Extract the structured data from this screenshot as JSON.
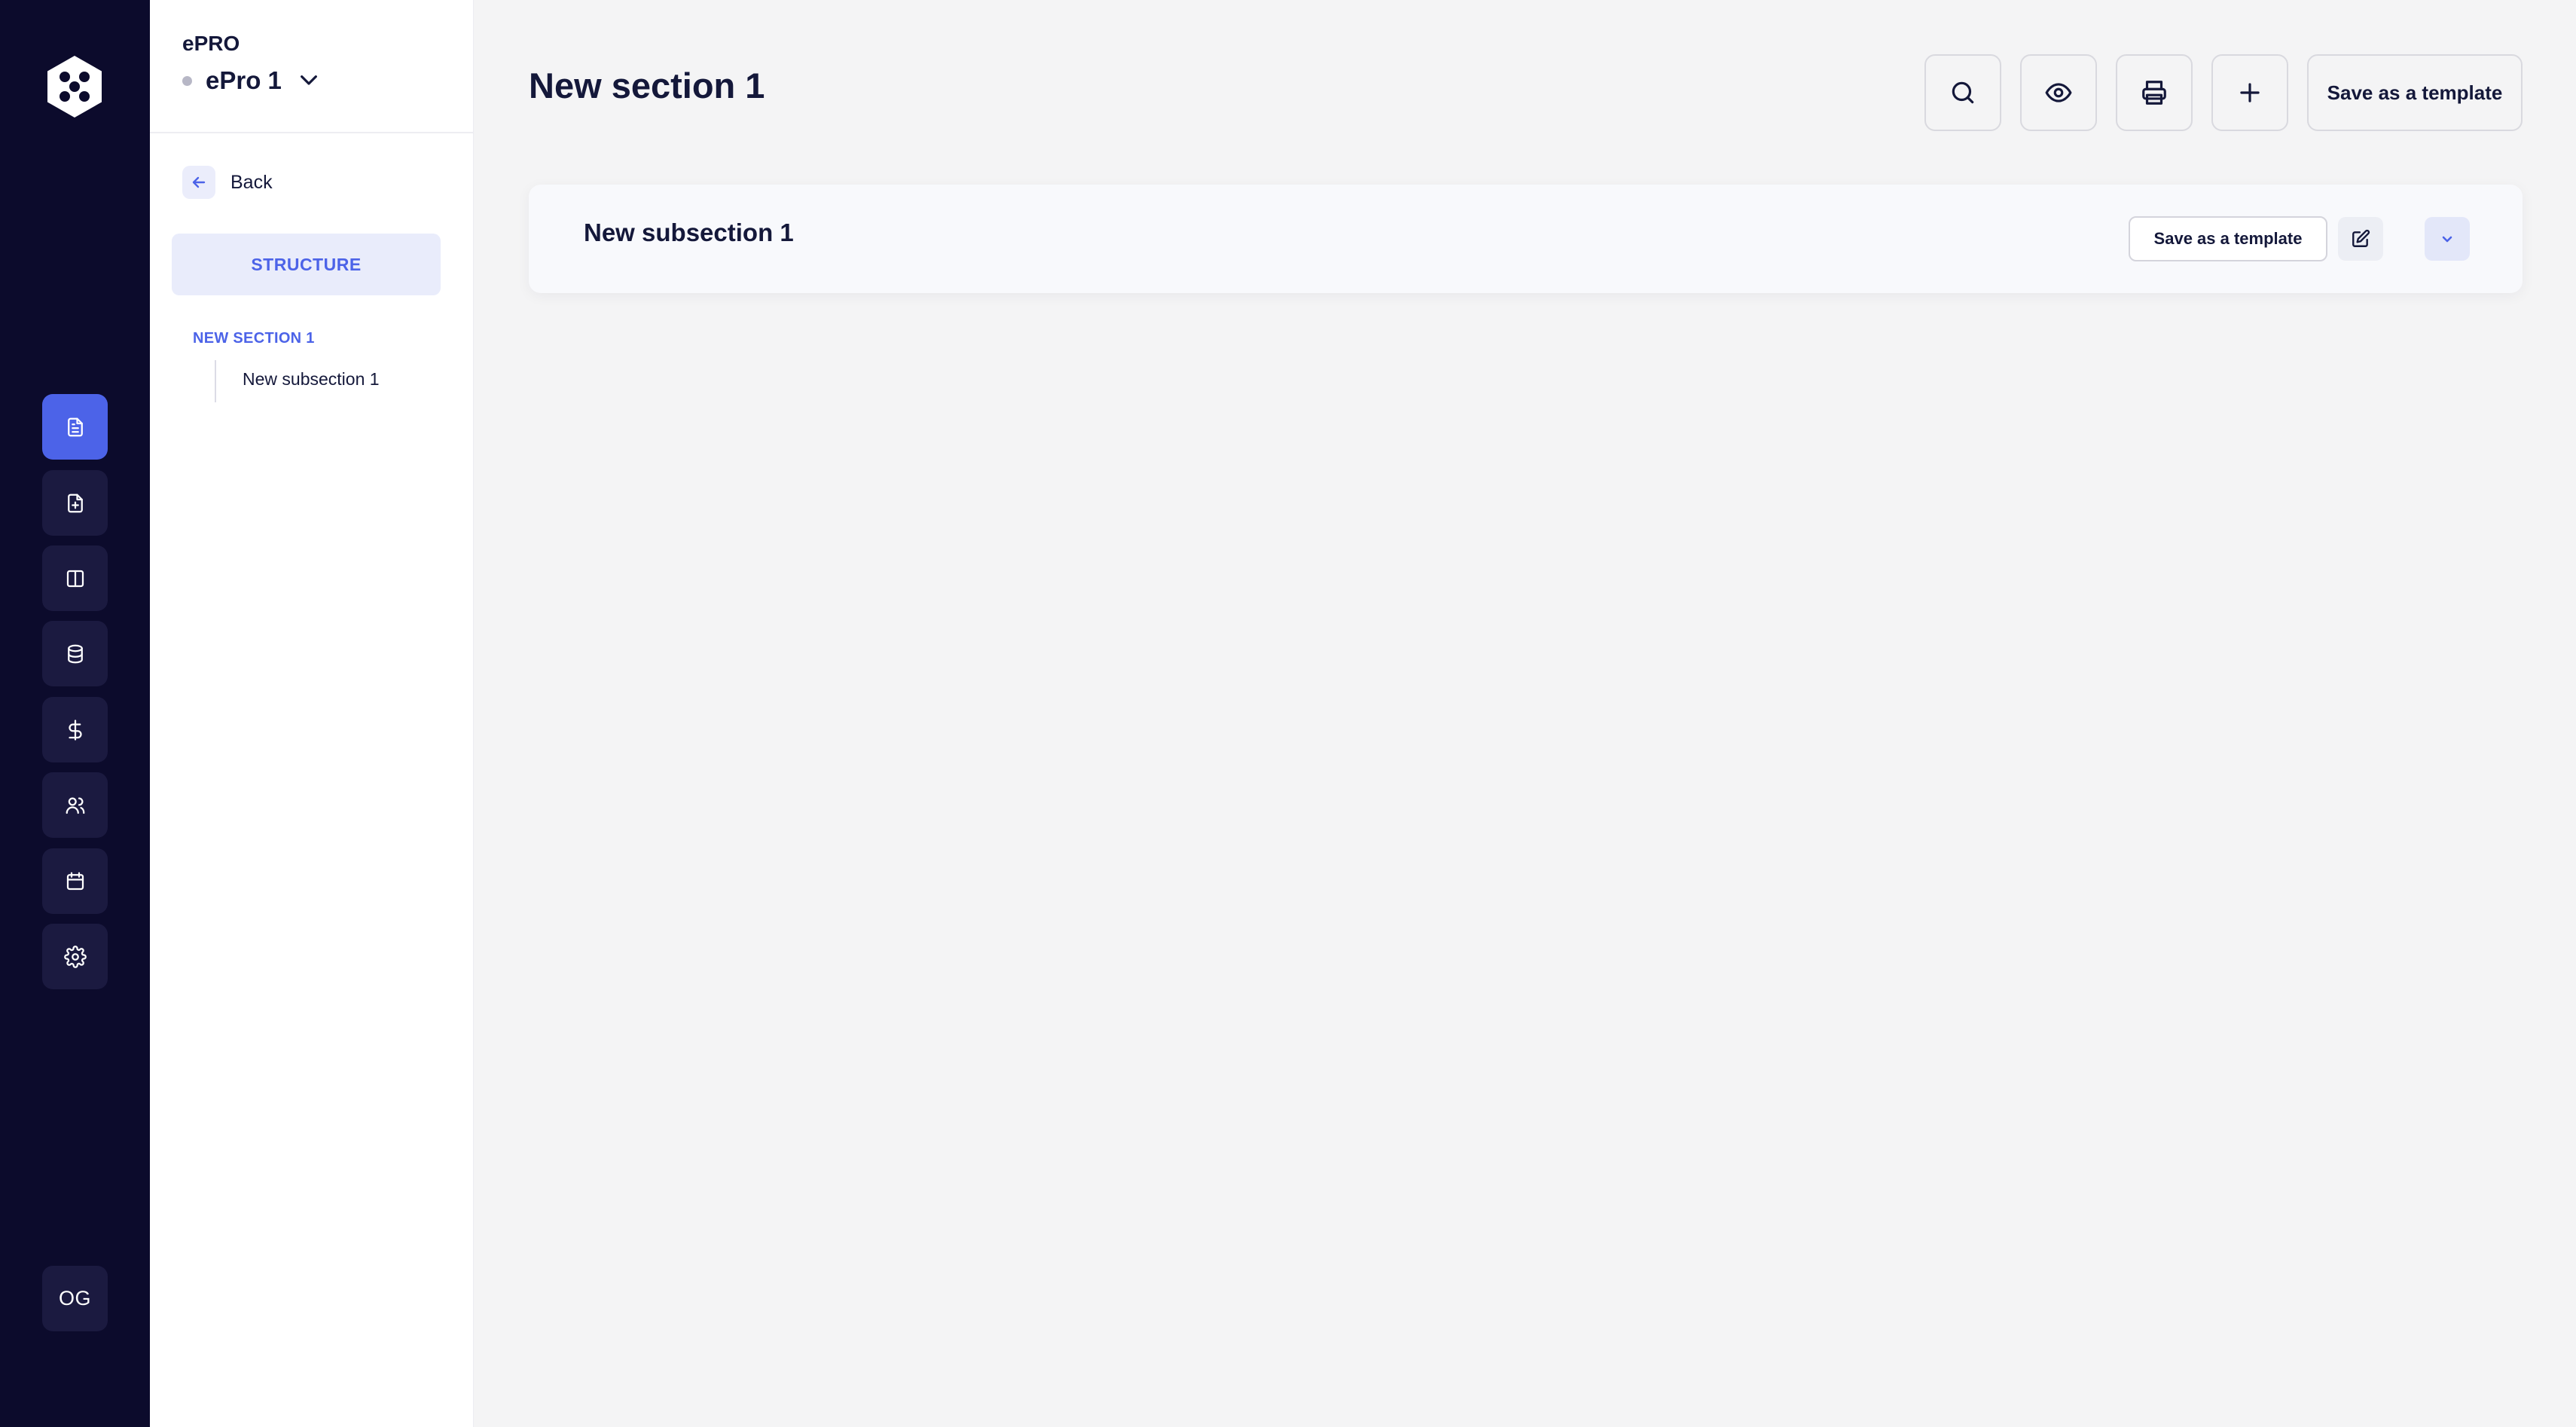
{
  "sidebar": {
    "app_name": "ePRO",
    "project_name": "ePro 1",
    "back_label": "Back",
    "structure_label": "STRUCTURE",
    "tree": {
      "section": "NEW SECTION 1",
      "subsection": "New subsection 1"
    }
  },
  "rail": {
    "items": [
      "document-icon",
      "file-plus-icon",
      "layout-columns-icon",
      "database-icon",
      "dollar-icon",
      "users-icon",
      "calendar-icon",
      "settings-icon"
    ],
    "active_index": 0,
    "user_initials": "OG"
  },
  "main": {
    "page_title": "New section 1",
    "toolbar": {
      "icons": [
        "search-icon",
        "eye-icon",
        "print-icon",
        "plus-icon"
      ],
      "save_template_label": "Save as a template"
    },
    "subsection": {
      "title": "New subsection 1",
      "save_template_label": "Save as a template"
    }
  },
  "colors": {
    "rail_bg": "#0c0b2c",
    "rail_btn_bg": "#1b1a40",
    "accent": "#4c63e8",
    "page_bg": "#f4f4f5",
    "text_primary": "#14183a"
  }
}
